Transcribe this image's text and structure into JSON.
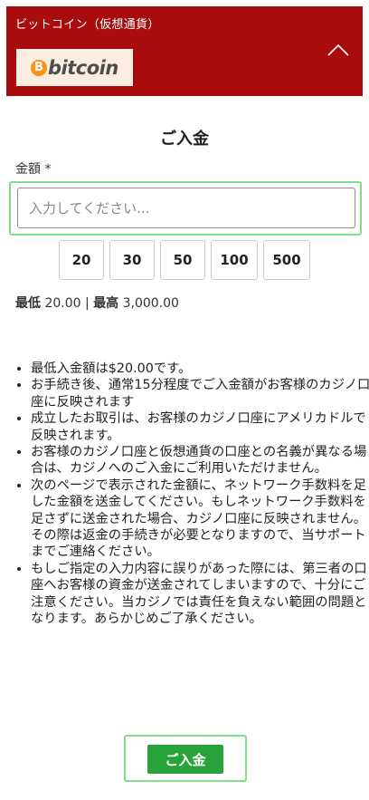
{
  "header": {
    "title": "ビットコイン（仮想通貨）",
    "logo_symbol": "B",
    "logo_text": "bitcoin",
    "collapse_icon": "chevron-up-icon"
  },
  "deposit": {
    "title": "ご入金",
    "amount_label": "金額 *",
    "amount_placeholder": "入力してください...",
    "amount_value": "",
    "presets": [
      "20",
      "30",
      "50",
      "100",
      "500"
    ],
    "min_label": "最低",
    "min_value": "20.00",
    "separator": "|",
    "max_label": "最高",
    "max_value": "3,000.00",
    "notes": [
      "最低入金額は$20.00です。",
      "お手続き後、通常15分程度でご入金額がお客様のカジノ口座に反映されます",
      "成立したお取引は、お客様のカジノ口座にアメリカドルで反映されます。",
      "お客様のカジノ口座と仮想通貨の口座との名義が異なる場合は、カジノへのご入金にご利用いただけません。",
      "次のページで表示された金額に、ネットワーク手数料を足した金額を送金してください。もしネットワーク手数料を足さずに送金された場合、カジノ口座に反映されません。その際は返金の手続きが必要となりますので、当サポートまでご連絡ください。",
      "もしご指定の入力内容に誤りがあった際には、第三者の口座へお客様の資金が送金されてしまいますので、十分にご注意ください。当カジノでは責任を負えない範囲の問題となります。あらかじめご了承ください。"
    ],
    "submit_label": "ご入金"
  },
  "colors": {
    "header_bg": "#a80c0c",
    "bitcoin_orange": "#f7931a",
    "submit_green": "#27a339",
    "highlight_green": "#7ee08a"
  }
}
